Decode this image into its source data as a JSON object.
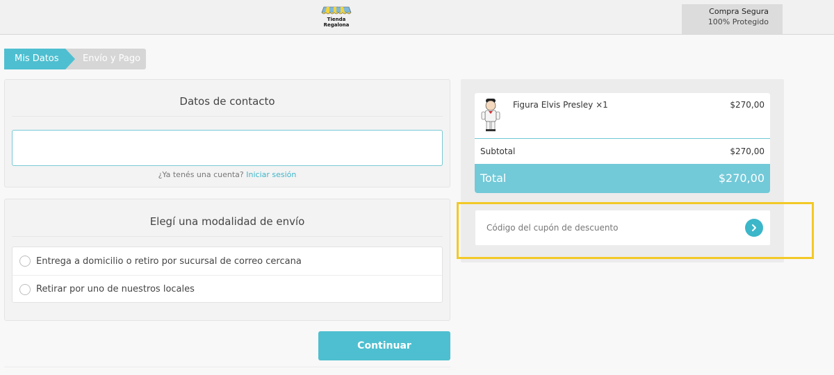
{
  "header": {
    "logo_text_line1": "Tienda",
    "logo_text_line2": "Regalona",
    "secure_title": "Compra Segura",
    "secure_subtitle": "100% Protegido"
  },
  "steps": [
    {
      "label": "Mis Datos",
      "active": true
    },
    {
      "label": "Envío y Pago",
      "active": false
    }
  ],
  "contact": {
    "title": "Datos de contacto",
    "email_value": "",
    "account_question": "¿Ya tenés una cuenta?",
    "login_link": "Iniciar sesión"
  },
  "shipping": {
    "title": "Elegí una modalidad de envío",
    "options": [
      {
        "label": "Entrega a domicilio o retiro por sucursal de correo cercana",
        "selected": false
      },
      {
        "label": "Retirar por uno de nuestros locales",
        "selected": false
      }
    ]
  },
  "actions": {
    "continue_label": "Continuar"
  },
  "summary": {
    "item_name": "Figura Elvis Presley ×1",
    "item_price": "$270,00",
    "subtotal_label": "Subtotal",
    "subtotal_value": "$270,00",
    "total_label": "Total",
    "total_value": "$270,00"
  },
  "coupon": {
    "placeholder": "Código del cupón de descuento"
  },
  "colors": {
    "accent": "#4ebfd0",
    "total_bar": "#72c9d8",
    "highlight": "#f3c926"
  }
}
